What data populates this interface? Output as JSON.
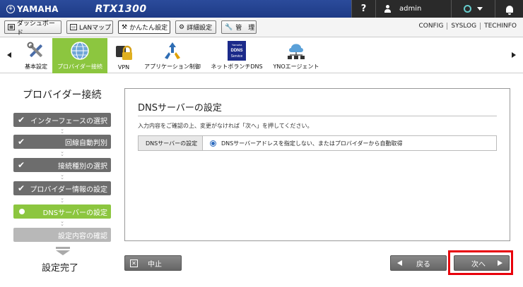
{
  "header": {
    "brand": "YAMAHA",
    "model": "RTX1300",
    "help_label": "?",
    "user_label": "admin"
  },
  "nav": {
    "tabs": [
      {
        "label": "ダッシュボード",
        "icon": "dashboard-icon"
      },
      {
        "label": "LANマップ",
        "icon": "lan-map-icon"
      },
      {
        "label": "かんたん設定",
        "icon": "wrench-person-icon",
        "active": true
      },
      {
        "label": "詳細設定",
        "icon": "gear-icon"
      },
      {
        "label": "管　理",
        "icon": "wrench-icon"
      }
    ],
    "links": [
      "CONFIG",
      "SYSLOG",
      "TECHINFO"
    ]
  },
  "ribbon": {
    "items": [
      {
        "label": "基本設定",
        "icon": "tools-icon"
      },
      {
        "label": "プロバイダー接続",
        "icon": "globe-icon",
        "active": true
      },
      {
        "label": "VPN",
        "icon": "lock-icon"
      },
      {
        "label": "アプリケーション制御",
        "icon": "app-control-icon"
      },
      {
        "label": "ネットボランチDNS",
        "icon": "dns-service-icon",
        "icon_text": [
          "Yamaha",
          "DDNS",
          "Service"
        ]
      },
      {
        "label": "YNOエージェント",
        "icon": "network-agent-icon"
      }
    ]
  },
  "steps": {
    "title": "プロバイダー接続",
    "items": [
      {
        "label": "インターフェースの選択",
        "state": "done"
      },
      {
        "label": "回線自動判別",
        "state": "done"
      },
      {
        "label": "接続種別の選択",
        "state": "done"
      },
      {
        "label": "プロバイダー情報の設定",
        "state": "done"
      },
      {
        "label": "DNSサーバーの設定",
        "state": "active"
      },
      {
        "label": "設定内容の確認",
        "state": "pending"
      }
    ],
    "done_label": "設定完了"
  },
  "panel": {
    "title": "DNSサーバーの設定",
    "description": "入力内容をご確認の上、変更がなければ「次へ」を押してください。",
    "field_label": "DNSサーバーの設定",
    "field_value": "DNSサーバーアドレスを指定しない、またはプロバイダーから自動取得"
  },
  "buttons": {
    "stop": "中止",
    "back": "戻る",
    "next": "次へ"
  },
  "colors": {
    "header_blue": "#1e3b86",
    "accent_green": "#8cc63f",
    "step_gray": "#6d6d6d",
    "highlight_red": "#e8000b"
  }
}
